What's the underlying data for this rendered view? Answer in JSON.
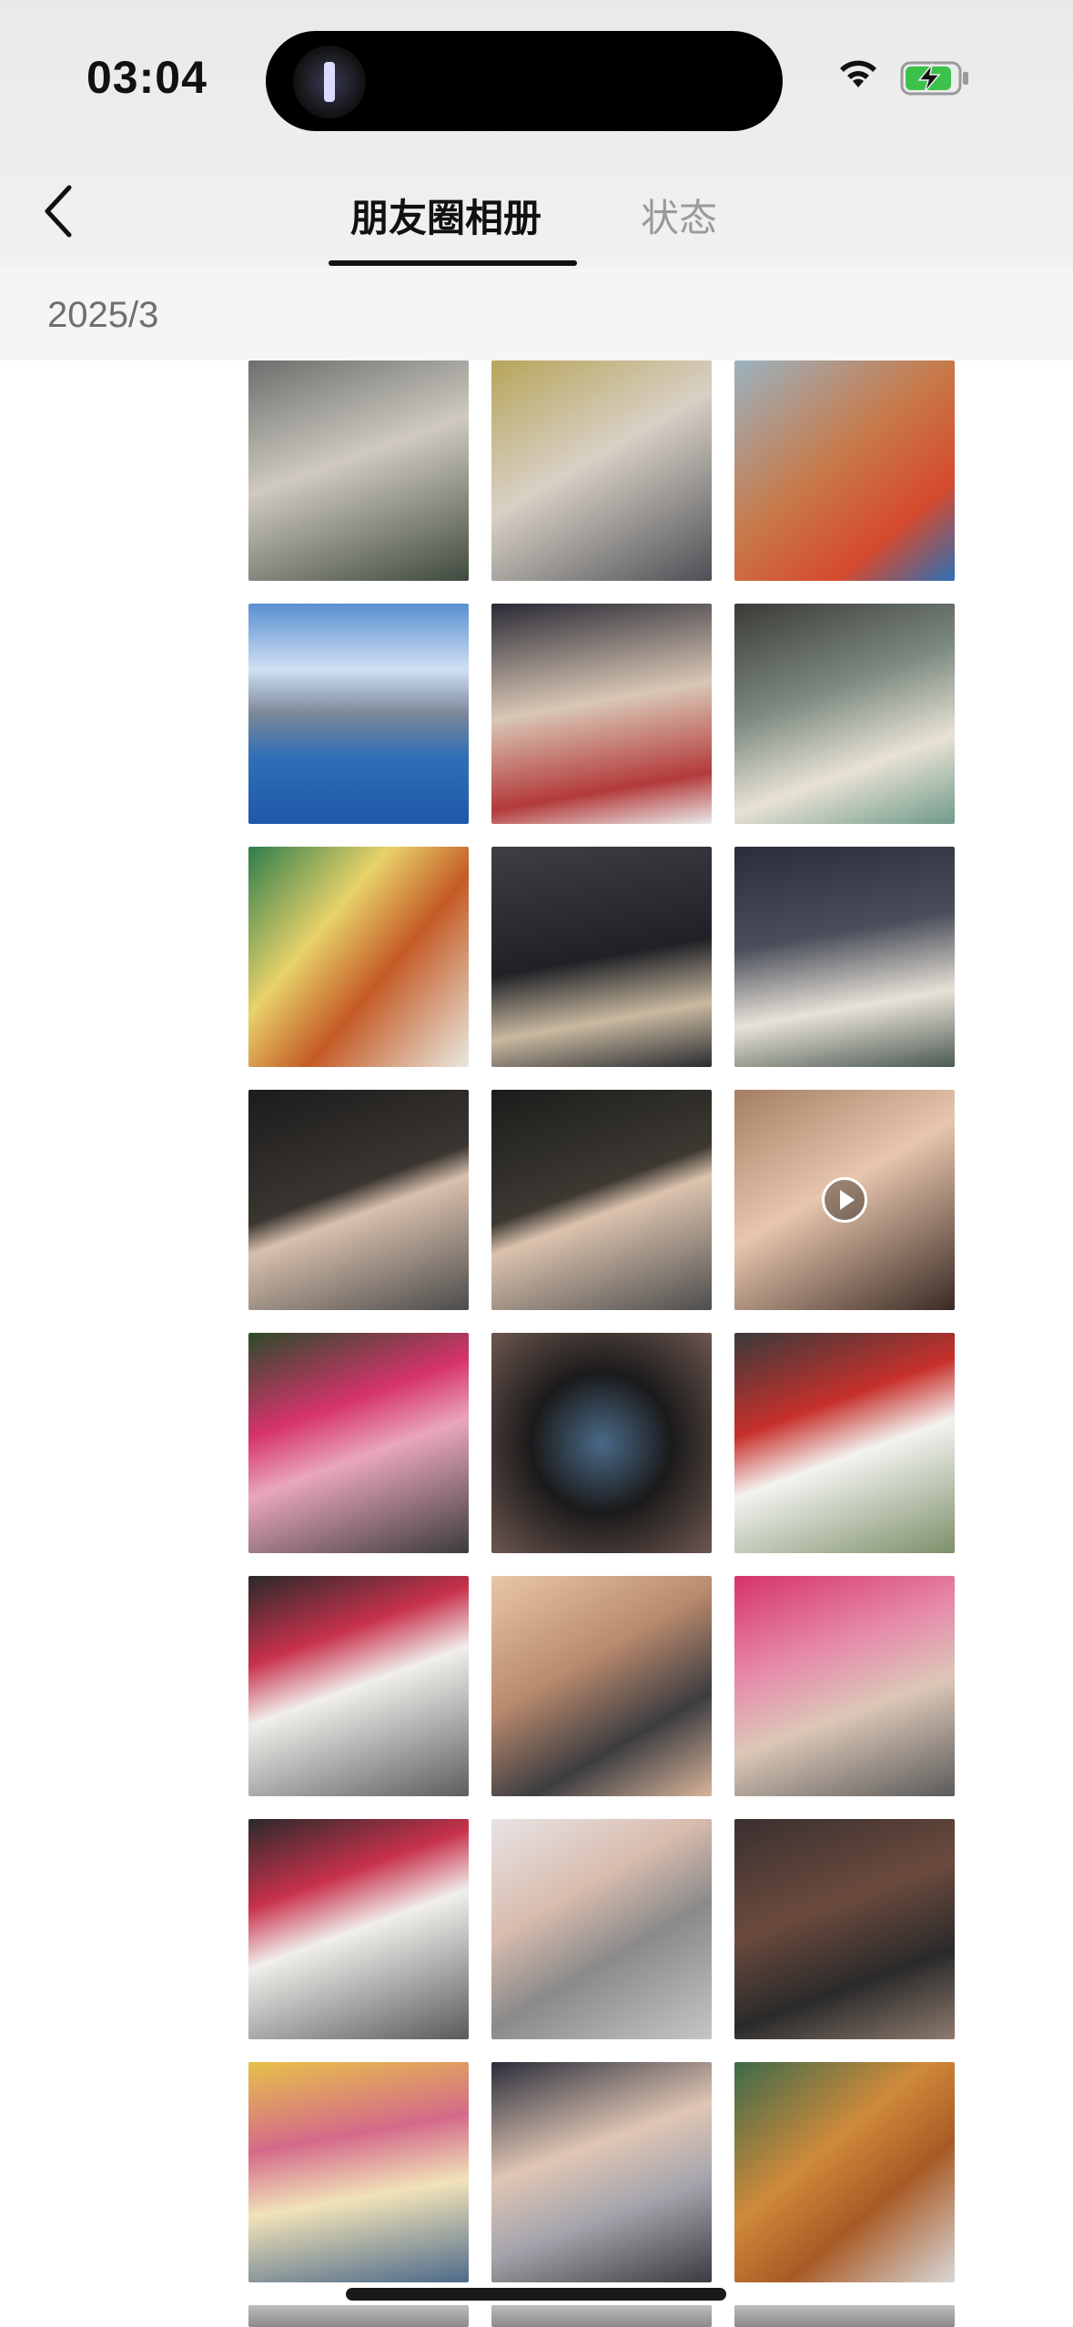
{
  "status_bar": {
    "time": "03:04"
  },
  "nav": {
    "tabs": [
      {
        "label": "朋友圈相册",
        "active": true
      },
      {
        "label": "状态",
        "active": false
      }
    ]
  },
  "section": {
    "date": "2025/3"
  },
  "photos": [
    {
      "name": "photo-girl-coconut",
      "bg": "linear-gradient(160deg,#6b6f6c 0%,#cfc9c1 45%,#3f4a3f 100%)"
    },
    {
      "name": "photo-girl-sugarcane",
      "bg": "linear-gradient(150deg,#b7a55a 0%,#d8d0c5 45%,#4c4f55 100%)"
    },
    {
      "name": "photo-food-plate",
      "bg": "linear-gradient(140deg,#9bb3c0 0%,#c77a4a 45%,#d64a2e 75%,#2d6fb5 100%)"
    },
    {
      "name": "photo-infinity-pool",
      "bg": "linear-gradient(180deg,#5a8fd1 0%,#cfe0f3 30%,#7a8798 50%,#2f6fb7 70%,#1e58a8 100%)"
    },
    {
      "name": "photo-girl-street",
      "bg": "linear-gradient(170deg,#2a2a35 0%,#d9c7b5 45%,#b33a3a 80%,#eaeaea 100%)"
    },
    {
      "name": "photo-girl-rooftop-bench",
      "bg": "linear-gradient(160deg,#3b3a38 0%,#7c8a80 40%,#e8e2d5 70%,#6f9a89 100%)"
    },
    {
      "name": "photo-ramadan-menu",
      "bg": "linear-gradient(130deg,#2f7d4b 0%,#e8d26a 35%,#c45a25 60%,#e9e9e0 100%)"
    },
    {
      "name": "photo-car-seat-teddy",
      "bg": "linear-gradient(170deg,#3d3f45 0%,#1f2126 50%,#c9b9a0 75%,#2a2c31 100%)"
    },
    {
      "name": "photo-girl-night-rooftop",
      "bg": "linear-gradient(170deg,#2b2e3a 0%,#4a4e5a 40%,#e8e2d8 70%,#4c5a52 100%)"
    },
    {
      "name": "photo-girl-night-stairs-1",
      "bg": "linear-gradient(160deg,#1c1c1c 0%,#3a3530 45%,#d9c0ad 55%,#4b4b4b 100%)"
    },
    {
      "name": "photo-girl-night-stairs-2",
      "bg": "linear-gradient(160deg,#1b1d1b 0%,#3d3832 45%,#dcc3ae 55%,#4d4d4d 100%)"
    },
    {
      "name": "photo-girl-selfie-video",
      "bg": "linear-gradient(150deg,#a47e64 0%,#e7c6ad 45%,#3a2a24 100%)",
      "video": true
    },
    {
      "name": "photo-girl-pink-flowers",
      "bg": "linear-gradient(160deg,#2d4a2a 0%,#d6336c 35%,#e9a6bc 55%,#3b3b3b 100%)"
    },
    {
      "name": "photo-camera-screen",
      "bg": "radial-gradient(circle at 50% 50%,#4a6a88 0%,#1a1a1a 45%,#6e5750 100%)"
    },
    {
      "name": "photo-flower-bouquets",
      "bg": "linear-gradient(160deg,#3a3a3a 0%,#c7302b 35%,#f3f3f0 55%,#7d8f6a 100%)"
    },
    {
      "name": "photo-girl-flowers-sitting-1",
      "bg": "linear-gradient(160deg,#2a2a2a 0%,#c8314c 30%,#f0efec 50%,#5d5d5d 100%)"
    },
    {
      "name": "photo-girl-phone-selfie",
      "bg": "linear-gradient(150deg,#e9c7a7 0%,#b98a6d 40%,#3c3c40 70%,#d8b49a 100%)"
    },
    {
      "name": "photo-girl-pink-flowers-2",
      "bg": "linear-gradient(160deg,#d6336c 0%,#e68aab 35%,#dcc7b7 60%,#5a5a5a 100%)"
    },
    {
      "name": "photo-girl-flowers-sitting-2",
      "bg": "linear-gradient(160deg,#2a2a2a 0%,#c8314c 30%,#f0efec 50%,#5a5a5a 100%)"
    },
    {
      "name": "photo-girl-grey-top",
      "bg": "linear-gradient(150deg,#e8e3e4 0%,#d8bcae 35%,#8a8a8a 60%,#c7c4c4 100%)"
    },
    {
      "name": "photo-blurry-restaurant",
      "bg": "linear-gradient(160deg,#3a3030 0%,#6b4a3d 40%,#2a2a2a 70%,#8d7a6d 100%)"
    },
    {
      "name": "photo-ice-cream-stall",
      "bg": "linear-gradient(170deg,#e7c04a 0%,#d46a8a 35%,#f1e3b8 60%,#4d6a8a 100%)"
    },
    {
      "name": "photo-girl-night-market",
      "bg": "linear-gradient(160deg,#2a2d3a 0%,#e0c6b4 40%,#a5a5ad 65%,#3a3a40 100%)"
    },
    {
      "name": "photo-curry-plate",
      "bg": "linear-gradient(140deg,#3d6a4a 0%,#cf8a3a 40%,#a85a25 65%,#d8d8d8 100%)"
    }
  ]
}
